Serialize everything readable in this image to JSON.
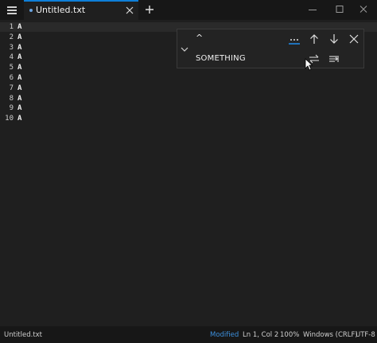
{
  "titlebar": {
    "tabs": [
      {
        "label": "Untitled.txt",
        "modified": true,
        "active": true
      }
    ],
    "menu_icon": "hamburger-menu-icon",
    "new_tab_icon": "plus-icon",
    "window_controls": [
      "minimize-icon",
      "maximize-icon",
      "close-icon"
    ]
  },
  "editor": {
    "line_numbers": [
      "1",
      "2",
      "3",
      "4",
      "5",
      "6",
      "7",
      "8",
      "9",
      "10"
    ],
    "lines": [
      "A",
      "A",
      "A",
      "A",
      "A",
      "A",
      "A",
      "A",
      "A",
      "A"
    ]
  },
  "find_replace": {
    "find_value": "^",
    "replace_value": "SOMETHING",
    "icons": {
      "options": "more-options-icon",
      "previous": "arrow-up-icon",
      "next": "arrow-down-icon",
      "close": "close-icon",
      "toggle": "chevron-down-icon",
      "replace": "replace-icon",
      "replace_all": "replace-all-icon"
    }
  },
  "statusbar": {
    "filename": "Untitled.txt",
    "modified": "Modified",
    "position": "Ln 1, Col 2",
    "zoom": "100%",
    "line_ending": "Windows (CRLF)",
    "encoding": "UTF-8"
  },
  "colors": {
    "accent": "#0e7fd8",
    "modified": "#3c8fdc",
    "background": "#1f1f1f",
    "chrome": "#171717"
  }
}
